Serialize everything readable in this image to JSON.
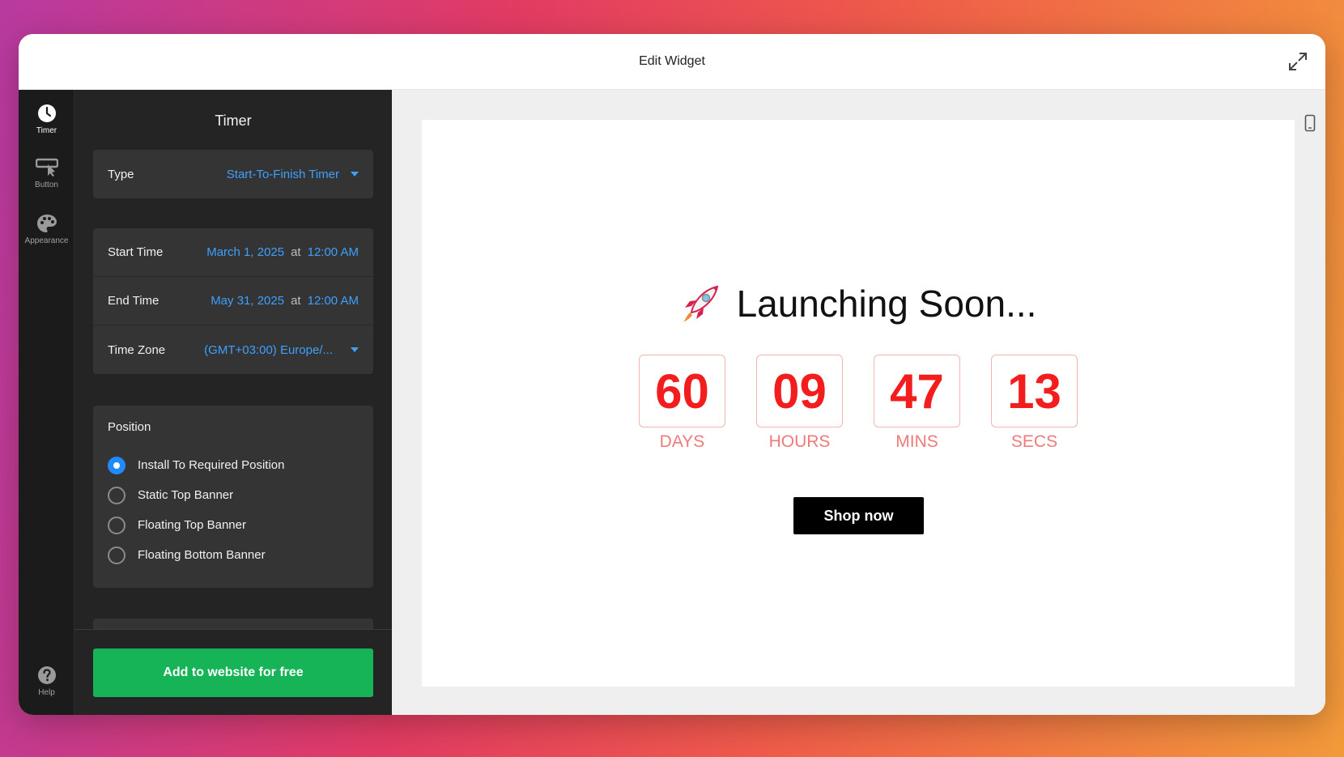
{
  "window": {
    "title": "Edit Widget"
  },
  "rail": {
    "items": [
      {
        "label": "Timer",
        "icon": "clock-icon",
        "active": true
      },
      {
        "label": "Button",
        "icon": "cursor-button-icon",
        "active": false
      },
      {
        "label": "Appearance",
        "icon": "palette-icon",
        "active": false
      }
    ],
    "help": {
      "label": "Help",
      "icon": "question-icon"
    }
  },
  "panel": {
    "title": "Timer",
    "type": {
      "label": "Type",
      "value": "Start-To-Finish Timer"
    },
    "start": {
      "label": "Start Time",
      "date": "March 1, 2025",
      "at": "at",
      "time": "12:00 AM"
    },
    "end": {
      "label": "End Time",
      "date": "May 31, 2025",
      "at": "at",
      "time": "12:00 AM"
    },
    "timezone": {
      "label": "Time Zone",
      "value": "(GMT+03:00) Europe/..."
    },
    "position": {
      "heading": "Position",
      "options": [
        "Install To Required Position",
        "Static Top Banner",
        "Floating Top Banner",
        "Floating Bottom Banner"
      ],
      "selected_index": 0
    },
    "cta": "Add to website for free"
  },
  "preview": {
    "headline": "Launching Soon...",
    "emoji": "🚀",
    "counter": [
      {
        "value": "60",
        "label": "DAYS"
      },
      {
        "value": "09",
        "label": "HOURS"
      },
      {
        "value": "47",
        "label": "MINS"
      },
      {
        "value": "13",
        "label": "SECS"
      }
    ],
    "button": "Shop now"
  },
  "colors": {
    "accent_blue": "#3ea0ff",
    "cta_green": "#16b357",
    "counter_red": "#f31d1d",
    "panel_bg": "#242424"
  }
}
